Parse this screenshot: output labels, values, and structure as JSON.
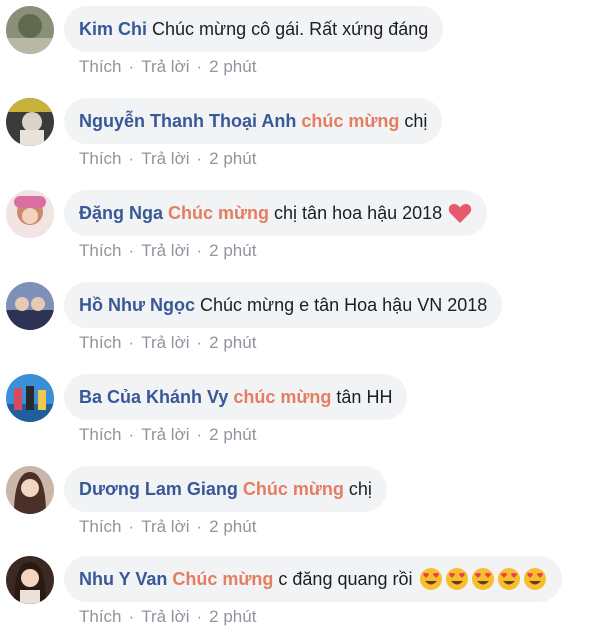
{
  "labels": {
    "like": "Thích",
    "reply": "Trả lời",
    "separator": "·"
  },
  "comments": [
    {
      "name": "Kim Chi",
      "highlight": "",
      "text": "Chúc mừng cô gái. Rất xứng đáng",
      "time": "2 phút",
      "emoji": ""
    },
    {
      "name": "Nguyễn Thanh Thoại Anh",
      "highlight": "chúc mừng",
      "text": "chị",
      "time": "2 phút",
      "emoji": ""
    },
    {
      "name": "Đặng Nga",
      "highlight": "Chúc mừng",
      "text": "chị tân hoa hậu 2018",
      "time": "2 phút",
      "emoji": "heart-emoji"
    },
    {
      "name": "Hồ Như Ngọc",
      "highlight": "",
      "text": "Chúc mừng e tân Hoa hậu VN 2018",
      "time": "2 phút",
      "emoji": ""
    },
    {
      "name": "Ba Của Khánh Vy",
      "highlight": "chúc mừng",
      "text": "tân HH",
      "time": "2 phút",
      "emoji": ""
    },
    {
      "name": "Dương Lam Giang",
      "highlight": "Chúc mừng",
      "text": "chị",
      "time": "2 phút",
      "emoji": ""
    },
    {
      "name": "Nhu Y Van",
      "highlight": "Chúc mừng",
      "text": "c đăng quang rồi",
      "time": "2 phút",
      "emoji": "heart-eyes-emoji x5"
    }
  ],
  "colors": {
    "name": "#385898",
    "highlight": "#e57d62",
    "meta": "#90949c",
    "bubble": "#f2f3f5",
    "heart": "#e8596e",
    "face": "#f7c02b"
  }
}
